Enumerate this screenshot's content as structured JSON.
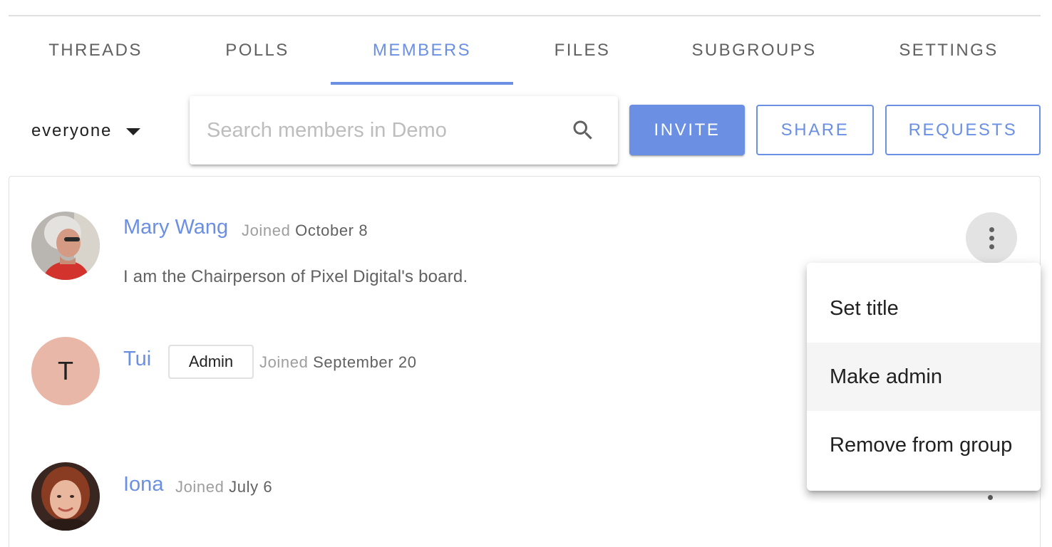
{
  "tabs": [
    {
      "label": "THREADS"
    },
    {
      "label": "POLLS"
    },
    {
      "label": "MEMBERS"
    },
    {
      "label": "FILES"
    },
    {
      "label": "SUBGROUPS"
    },
    {
      "label": "SETTINGS"
    }
  ],
  "active_tab": "MEMBERS",
  "toolbar": {
    "filter_value": "everyone",
    "search_placeholder": "Search members in Demo",
    "search_value": "",
    "invite_label": "INVITE",
    "share_label": "SHARE",
    "requests_label": "REQUESTS"
  },
  "members": [
    {
      "name": "Mary Wang",
      "joined_label": "Joined",
      "joined_date": "October 8",
      "bio": "I am the Chairperson of Pixel Digital's board.",
      "avatar": "photo"
    },
    {
      "name": "Tui",
      "badge": "Admin",
      "joined_label": "Joined",
      "joined_date": "September 20",
      "avatar_letter": "T"
    },
    {
      "name": "Iona",
      "joined_label": "Joined",
      "joined_date": "July 6",
      "avatar": "photo"
    }
  ],
  "menu": {
    "items": [
      {
        "label": "Set title"
      },
      {
        "label": "Make admin"
      },
      {
        "label": "Remove from group"
      }
    ],
    "hovered_item": "Make admin"
  },
  "colors": {
    "accent": "#6a8fe3",
    "tab_inactive": "#616161",
    "divider": "#e0e0e0",
    "avatar_letter_bg": "#e9b7a8"
  },
  "icons": {
    "search": "search-icon",
    "filter_dropdown": "caret-down-icon",
    "member_menu": "more-vert-icon"
  }
}
